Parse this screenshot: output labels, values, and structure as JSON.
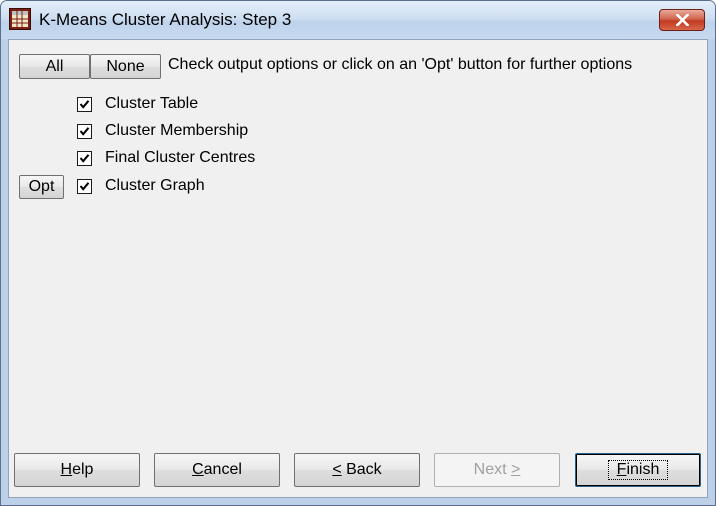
{
  "window": {
    "title": "K-Means Cluster Analysis: Step 3"
  },
  "toolbar": {
    "all_label": "All",
    "none_label": "None",
    "hint": "Check output options or click on an 'Opt' button for further options"
  },
  "options": [
    {
      "label": "Cluster Table",
      "checked": true
    },
    {
      "label": "Cluster Membership",
      "checked": true
    },
    {
      "label": "Final Cluster Centres",
      "checked": true
    },
    {
      "label": "Cluster Graph",
      "checked": true,
      "opt_label": "Opt"
    }
  ],
  "footer": {
    "help_label": {
      "mnemonic": "H",
      "rest": "elp"
    },
    "cancel_label": {
      "mnemonic": "C",
      "rest": "ancel"
    },
    "back_label": {
      "mnemonic": "<",
      "rest": " Back"
    },
    "next_label": {
      "text": "Next ",
      "mnemonic": ">"
    },
    "finish_label": {
      "mnemonic": "F",
      "rest": "inish"
    }
  }
}
